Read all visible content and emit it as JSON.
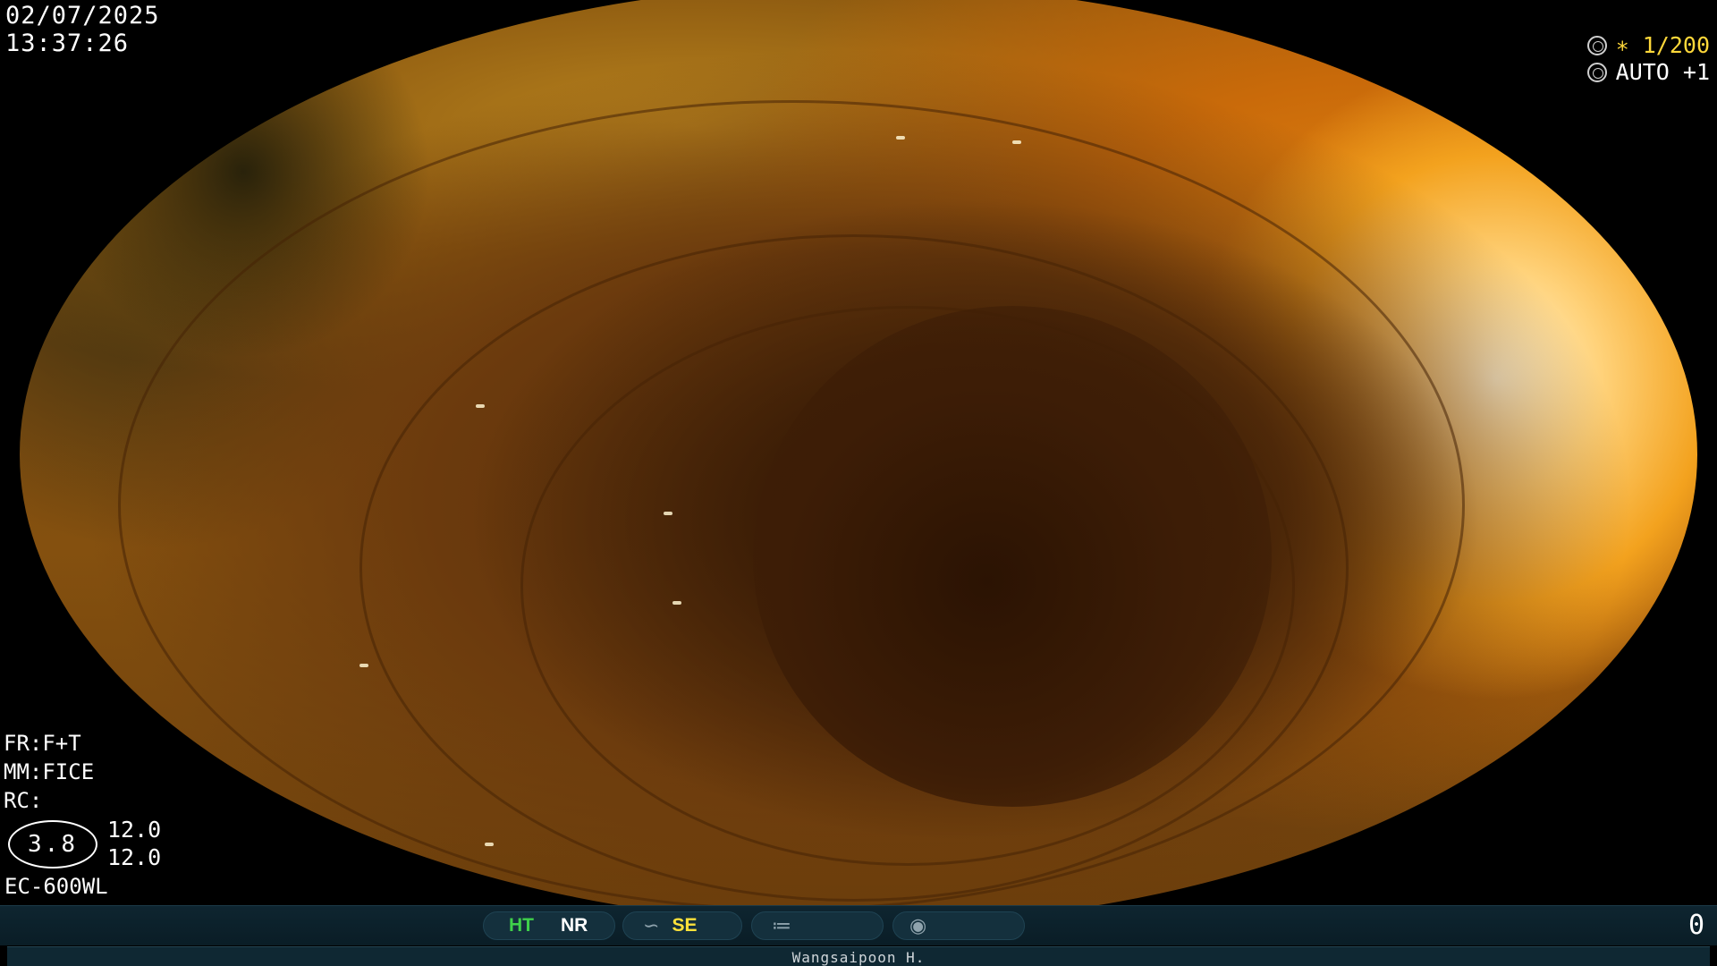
{
  "header": {
    "date": "02/07/2025",
    "time": "13:37:26"
  },
  "exposure": {
    "shutter_icon": "shutter-icon",
    "shutter": "∗ 1/200",
    "iris_icon": "iris-icon",
    "auto": "AUTO +1",
    "accent_color": "#ffd83a"
  },
  "settings": {
    "fr": "FR:F+T",
    "mm": "MM:FICE",
    "rc": "RC:"
  },
  "zoom": {
    "badge": "3.8",
    "value_top": "12.0",
    "value_bottom": "12.0"
  },
  "scope": {
    "model": "EC-600WL"
  },
  "status_bar": {
    "ht": "HT",
    "nr": "NR",
    "se": "SE",
    "ht_color": "#3fd14a",
    "se_color": "#ffe23a",
    "structure_icon": "structure-enhance-icon",
    "color_icon": "color-mode-icon",
    "capture_icon": "capture-icon",
    "counter": "0"
  },
  "operator": {
    "name": "Wangsaipoon H."
  }
}
